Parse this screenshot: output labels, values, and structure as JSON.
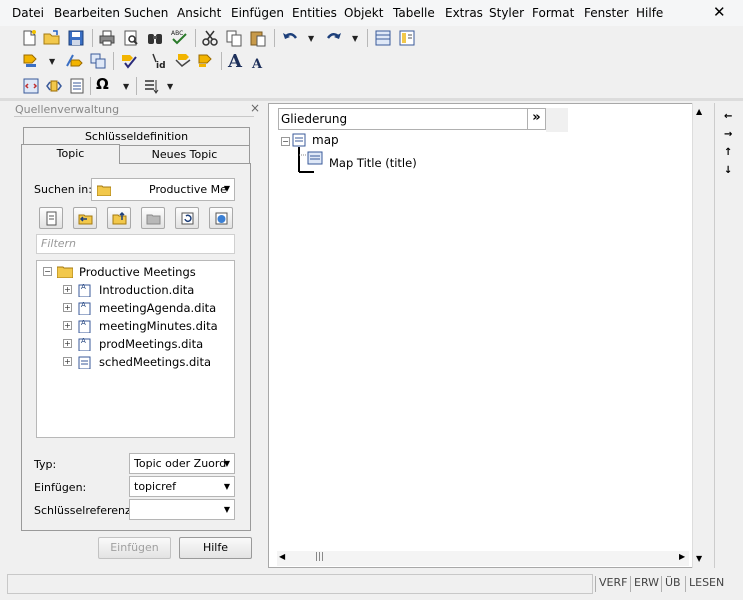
{
  "menu": {
    "items": [
      "Datei",
      "Bearbeiten",
      "Suchen",
      "Ansicht",
      "Einfügen",
      "Entities",
      "Objekt",
      "Tabelle",
      "Extras",
      "Styler",
      "Format",
      "Fenster",
      "Hilfe"
    ],
    "close": "✕"
  },
  "toolbar": {
    "row1_icons": [
      "new-file-icon",
      "open-folder-icon",
      "save-icon",
      "print-icon",
      "print-preview-icon",
      "find-icon",
      "spellcheck-icon",
      "cut-icon",
      "copy-icon",
      "paste-icon",
      "undo-icon",
      "redo-icon",
      "table-view-icon",
      "page-view-icon"
    ],
    "spellcheck_label": "ABC",
    "row2_icons": [
      "tag-icon",
      "insert-tag-icon",
      "split-icon",
      "validate-icon",
      "id-icon",
      "set-attribute-icon",
      "styler-icon",
      "font-larger-icon",
      "font-smaller-icon"
    ],
    "id_label": "id",
    "font_larger": "A",
    "font_smaller": "A",
    "row3_icons": [
      "xml-icon",
      "xml-edit-icon",
      "list-icon",
      "omega-icon",
      "sort-icon"
    ],
    "omega": "Ω"
  },
  "left_panel": {
    "title": "Quellenverwaltung",
    "close": "×",
    "tabs": {
      "keydef": "Schlüsseldefinition",
      "topic": "Topic",
      "new_topic": "Neues Topic"
    },
    "search_in": {
      "label": "Suchen in:",
      "value": "Productive Me"
    },
    "filter_placeholder": "Filtern",
    "tree": {
      "root": "Productive Meetings",
      "children": [
        "Introduction.dita",
        "meetingAgenda.dita",
        "meetingMinutes.dita",
        "prodMeetings.dita",
        "schedMeetings.dita"
      ]
    },
    "type": {
      "label": "Typ:",
      "value": "Topic oder Zuord"
    },
    "insert": {
      "label": "Einfügen:",
      "value": "topicref"
    },
    "keyref": {
      "label": "Schlüsselreferenz:",
      "value": ""
    },
    "buttons": {
      "insert": "Einfügen",
      "help": "Hilfe"
    }
  },
  "editor": {
    "outline_title": "Gliederung",
    "outline_toggle": "»",
    "map_label": "map",
    "map_title_label": "Map Title (title)",
    "hscroll_grip": "|||"
  },
  "right_bar": {
    "arrows": [
      "←",
      "→",
      "↑",
      "↓"
    ]
  },
  "status": {
    "cells": [
      "VERF",
      "ERW",
      "ÜB",
      "LESEN"
    ]
  }
}
